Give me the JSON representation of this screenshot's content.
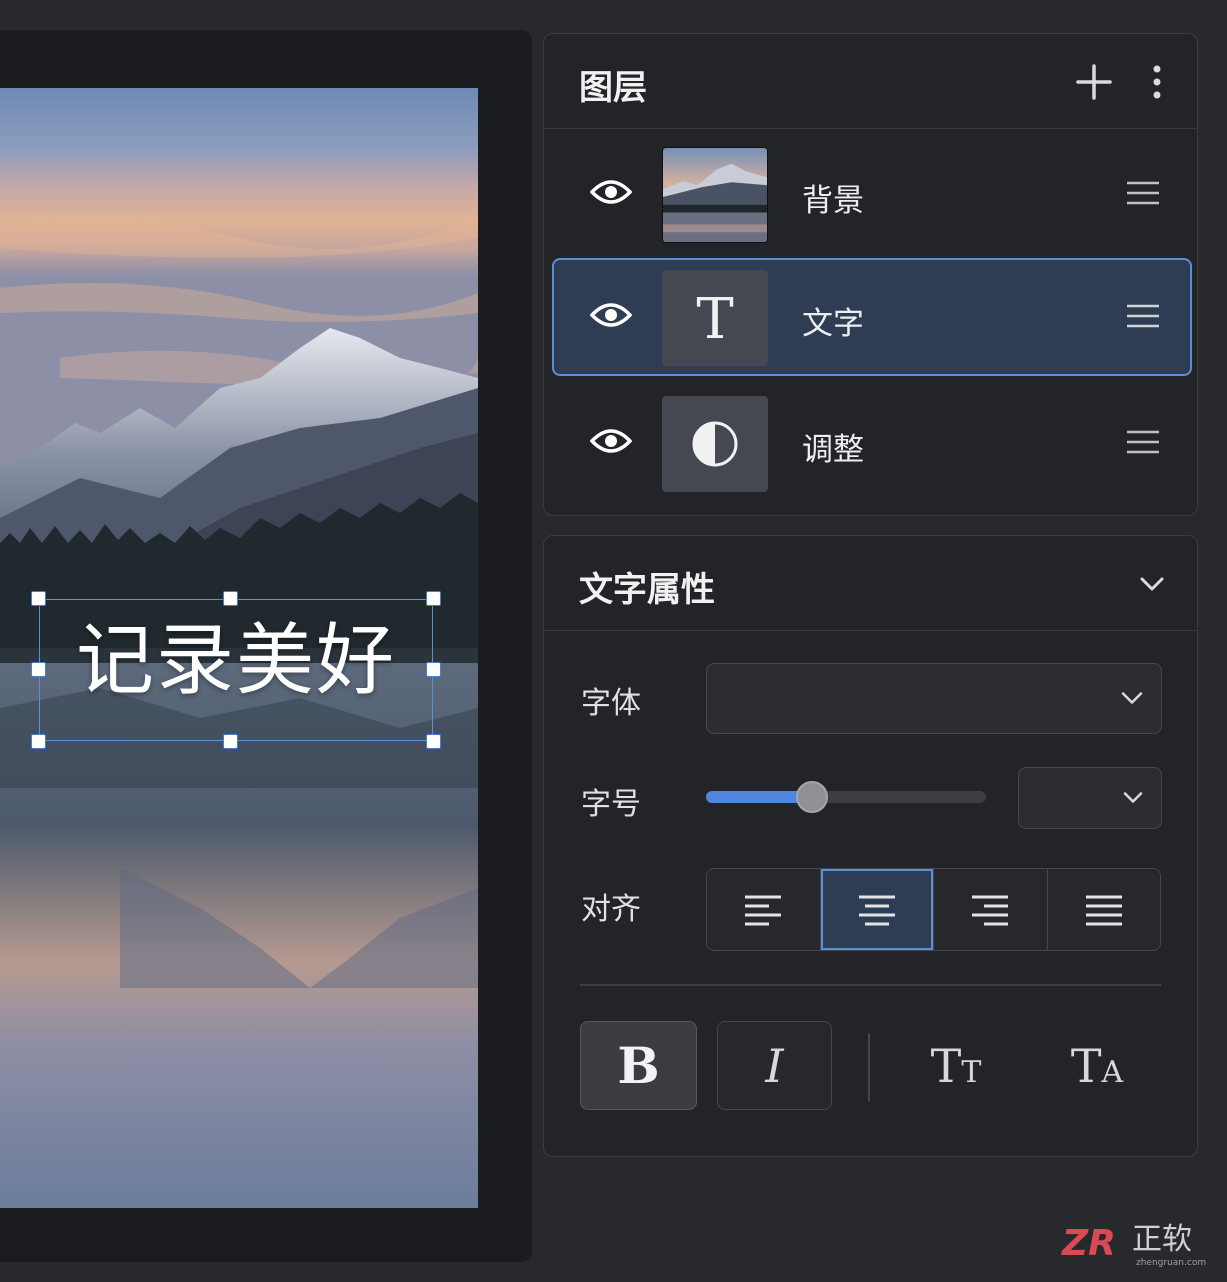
{
  "canvas": {
    "text_overlay": "记录美好"
  },
  "layers_panel": {
    "title": "图层",
    "add_icon": "plus-icon",
    "menu_icon": "more-vertical-icon",
    "layers": [
      {
        "name": "背景",
        "visible": true,
        "thumb": "landscape-thumbnail",
        "active": false
      },
      {
        "name": "文字",
        "visible": true,
        "thumb": "text-T-icon",
        "active": true
      },
      {
        "name": "调整",
        "visible": true,
        "thumb": "half-circle-adjust-icon",
        "active": false
      }
    ]
  },
  "text_properties": {
    "title": "文字属性",
    "collapse_icon": "chevron-down-icon",
    "font_label": "字体",
    "font_value": "",
    "size_label": "字号",
    "size_value": "",
    "size_slider_fraction": 0.38,
    "align_label": "对齐",
    "align_options": [
      "left",
      "center",
      "right",
      "justify"
    ],
    "align_selected": "center",
    "style_buttons": {
      "bold": "B",
      "italic": "I",
      "small_caps": "TT",
      "all_caps": "TA"
    }
  },
  "watermark": {
    "brand": "ZR",
    "text": "正软",
    "url_text": "zhengruan.com"
  },
  "colors": {
    "accent": "#5b8fd6",
    "panel_bg": "#232428",
    "active_bg": "#2f3d54"
  }
}
